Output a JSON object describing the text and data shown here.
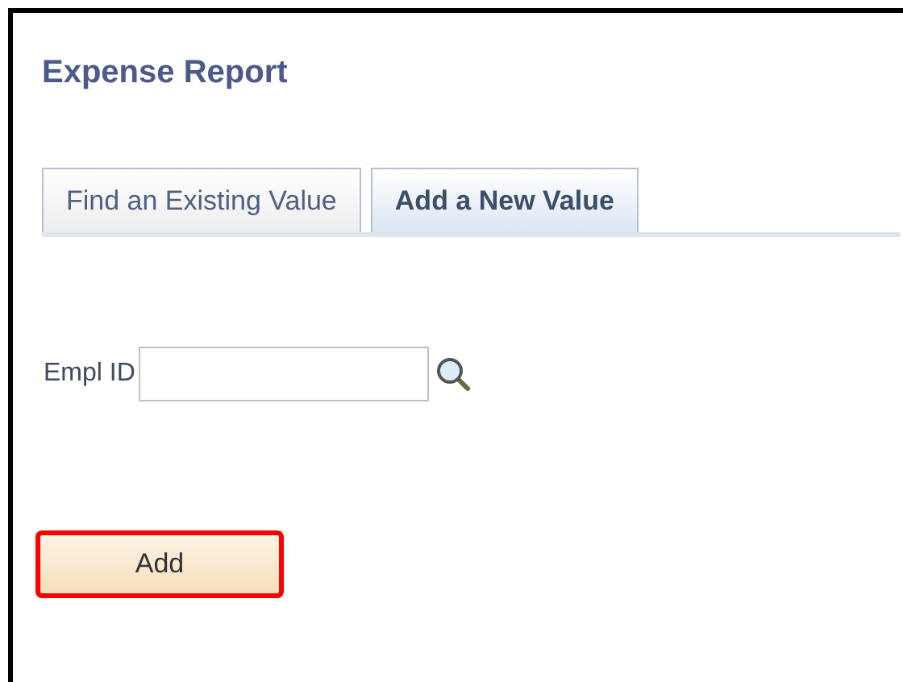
{
  "page": {
    "title": "Expense Report"
  },
  "tabs": [
    {
      "label": "Find an Existing Value",
      "selected": false
    },
    {
      "label": "Add a New Value",
      "selected": true
    }
  ],
  "field": {
    "label": "Empl ID"
  },
  "button": {
    "label": "Add",
    "highlighted": true
  }
}
